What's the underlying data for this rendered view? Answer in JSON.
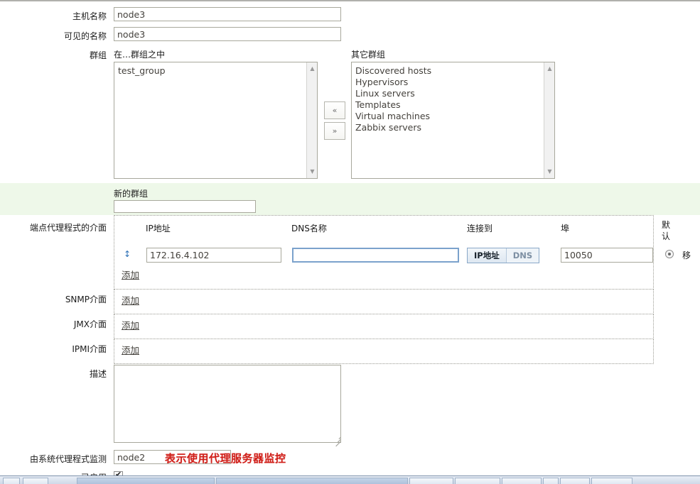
{
  "form": {
    "host_name": {
      "label": "主机名称",
      "value": "node3"
    },
    "visible_name": {
      "label": "可见的名称",
      "value": "node3"
    },
    "groups": {
      "label": "群组",
      "in_groups_label": "在…群组之中",
      "other_groups_label": "其它群组",
      "in_groups": [
        "test_group"
      ],
      "other_groups": [
        "Discovered hosts",
        "Hypervisors",
        "Linux servers",
        "Templates",
        "Virtual machines",
        "Zabbix servers"
      ],
      "move_left_label": "«",
      "move_right_label": "»"
    },
    "new_group": {
      "label": "新的群组",
      "value": "",
      "placeholder": ""
    },
    "agent_interfaces": {
      "label": "端点代理程式的介面",
      "columns": {
        "ip": "IP地址",
        "dns": "DNS名称",
        "connect_to": "连接到",
        "port": "埠",
        "default": "默认"
      },
      "rows": [
        {
          "ip": "172.16.4.102",
          "dns": "",
          "connect_to_ip_label": "IP地址",
          "connect_to_dns_label": "DNS",
          "connect_to_selected": "IP地址",
          "port": "10050",
          "remove_label": "移"
        }
      ],
      "add_label": "添加"
    },
    "snmp_interfaces": {
      "label": "SNMP介面",
      "add_label": "添加"
    },
    "jmx_interfaces": {
      "label": "JMX介面",
      "add_label": "添加"
    },
    "ipmi_interfaces": {
      "label": "IPMI介面",
      "add_label": "添加"
    },
    "description": {
      "label": "描述",
      "value": ""
    },
    "monitored_by_proxy": {
      "label": "由系统代理程式监测",
      "value": "node2"
    },
    "enabled": {
      "label": "已启用",
      "checked": true
    }
  },
  "annotation": {
    "text": "表示使用代理服务器监控",
    "color": "#d0201a"
  },
  "colors": {
    "green_band": "#eef8e9",
    "field_border": "#a8a89c",
    "focus_border": "#7ba2cc",
    "accent_blue": "#2a6fb5"
  }
}
